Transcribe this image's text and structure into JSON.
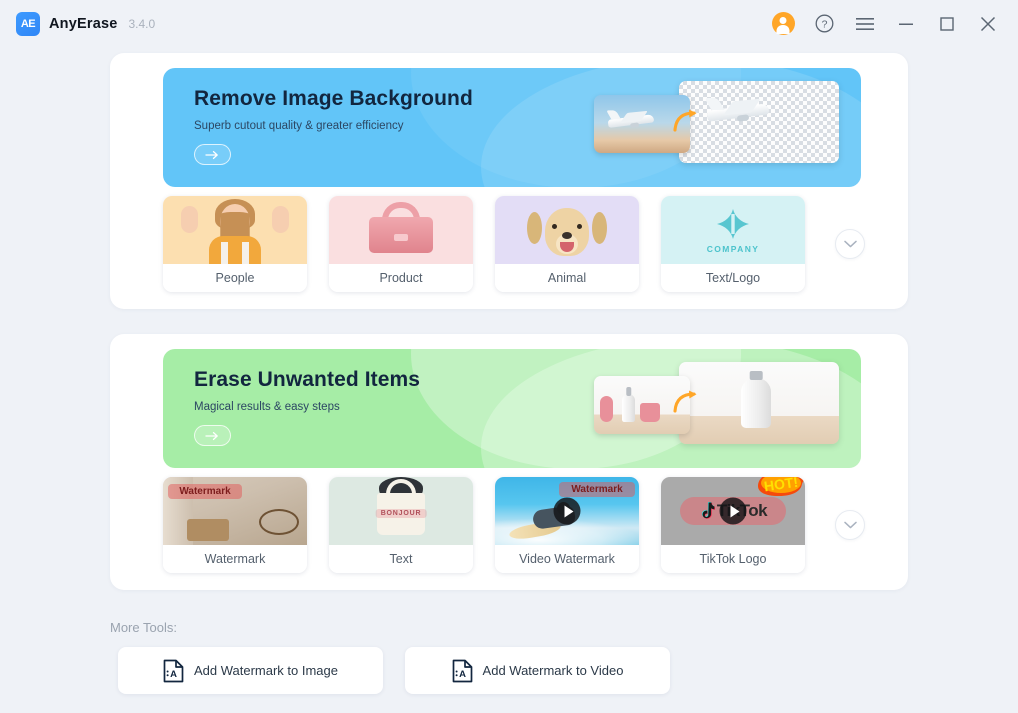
{
  "titlebar": {
    "logo_text": "AE",
    "app_name": "AnyErase",
    "version": "3.4.0",
    "controls": [
      {
        "name": "account-avatar",
        "label": "Account"
      },
      {
        "name": "help-icon",
        "label": "Help"
      },
      {
        "name": "menu-icon",
        "label": "Menu"
      },
      {
        "name": "minimize-icon",
        "label": "Minimize"
      },
      {
        "name": "maximize-icon",
        "label": "Maximize"
      },
      {
        "name": "close-icon",
        "label": "Close"
      }
    ]
  },
  "colors": {
    "page_bg": "#eff2f7",
    "panel_bg": "#ffffff",
    "banner_blue": "#62c5f8",
    "banner_green": "#a6eda6",
    "accent_orange": "#ffa628",
    "selection_red": "#f01414",
    "heading": "#12263f"
  },
  "background_section": {
    "banner": {
      "title": "Remove Image Background",
      "subtitle": "Superb cutout quality & greater efficiency",
      "cta_icon": "arrow-right-icon"
    },
    "cards": [
      {
        "label": "People",
        "thumb": "girl-portrait-thumbnail"
      },
      {
        "label": "Product",
        "thumb": "pink-handbag-thumbnail"
      },
      {
        "label": "Animal",
        "thumb": "golden-retriever-thumbnail"
      },
      {
        "label": "Text/Logo",
        "thumb": "company-logo-thumbnail",
        "logo_text": "COMPANY"
      }
    ],
    "expand_icon": "chevron-down-icon"
  },
  "erase_section": {
    "banner": {
      "title": "Erase Unwanted Items",
      "subtitle": "Magical results & easy steps",
      "cta_icon": "arrow-right-icon"
    },
    "cards": [
      {
        "label": "Watermark",
        "thumb": "bicycle-watermark-thumbnail",
        "overlay_text": "Watermark",
        "selected": false,
        "has_play": false,
        "badge": ""
      },
      {
        "label": "Text",
        "thumb": "tote-bag-thumbnail",
        "overlay_text": "BONJOUR",
        "selected": false,
        "has_play": false,
        "badge": ""
      },
      {
        "label": "Video Watermark",
        "thumb": "surfer-video-thumbnail",
        "overlay_text": "Watermark",
        "selected": true,
        "has_play": true,
        "badge": ""
      },
      {
        "label": "TikTok Logo",
        "thumb": "tiktok-video-thumbnail",
        "overlay_text": "TikTok",
        "selected": false,
        "has_play": true,
        "badge": "HOT!"
      }
    ],
    "expand_icon": "chevron-down-icon"
  },
  "more_tools": {
    "label": "More Tools:",
    "buttons": [
      {
        "label": "Add Watermark to Image",
        "icon": "document-text-icon"
      },
      {
        "label": "Add Watermark to Video",
        "icon": "document-text-icon"
      }
    ]
  }
}
